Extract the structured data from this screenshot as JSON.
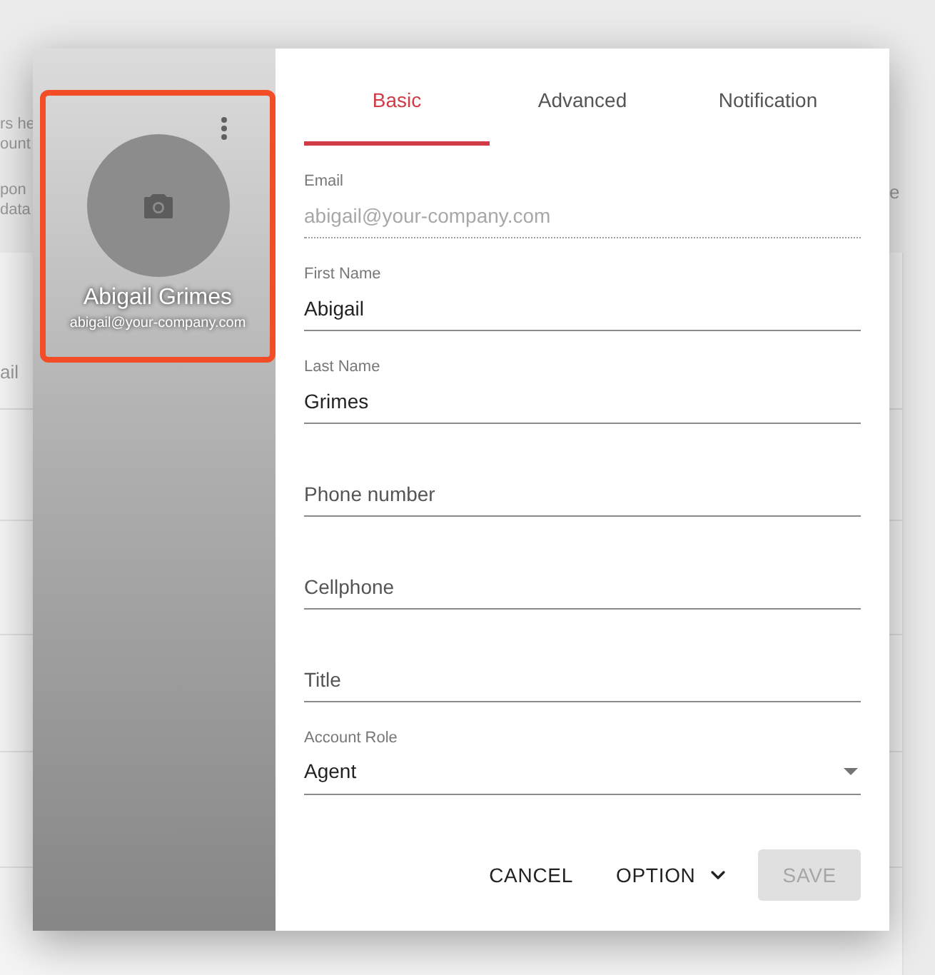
{
  "background": {
    "left_fragments": [
      "rs he",
      "ount",
      "pon",
      "data"
    ],
    "row_fragment": "ail",
    "right_fragment": "e"
  },
  "profile": {
    "name": "Abigail Grimes",
    "email": "abigail@your-company.com",
    "highlighted": true
  },
  "tabs": [
    {
      "label": "Basic",
      "selected": true
    },
    {
      "label": "Advanced",
      "selected": false
    },
    {
      "label": "Notification",
      "selected": false
    }
  ],
  "fields": [
    {
      "kind": "text",
      "label": "Email",
      "value": "abigail@your-company.com",
      "disabled": true
    },
    {
      "kind": "text",
      "label": "First Name",
      "value": "Abigail",
      "disabled": false
    },
    {
      "kind": "text",
      "label": "Last Name",
      "value": "Grimes",
      "disabled": false
    },
    {
      "kind": "text",
      "placeholder": "Phone number",
      "disabled": false
    },
    {
      "kind": "text",
      "placeholder": "Cellphone",
      "disabled": false
    },
    {
      "kind": "text",
      "placeholder": "Title",
      "disabled": false
    },
    {
      "kind": "select",
      "label": "Account Role",
      "value": "Agent",
      "disabled": false
    }
  ],
  "actions": [
    {
      "kind": "text",
      "label": "CANCEL",
      "disabled": false
    },
    {
      "kind": "menu",
      "label": "OPTION",
      "disabled": false
    },
    {
      "kind": "contained",
      "label": "SAVE",
      "disabled": true
    }
  ]
}
